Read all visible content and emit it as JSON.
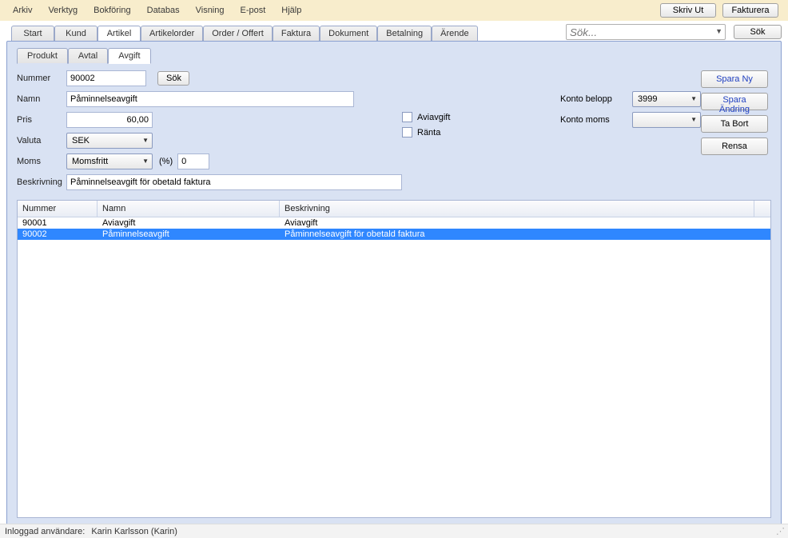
{
  "menu": [
    "Arkiv",
    "Verktyg",
    "Bokföring",
    "Databas",
    "Visning",
    "E-post",
    "Hjälp"
  ],
  "topButtons": {
    "print": "Skriv Ut",
    "invoice": "Fakturera"
  },
  "search": {
    "placeholder": "Sök...",
    "button": "Sök"
  },
  "mainTabs": [
    "Start",
    "Kund",
    "Artikel",
    "Artikelorder",
    "Order / Offert",
    "Faktura",
    "Dokument",
    "Betalning",
    "Ärende"
  ],
  "mainActive": 2,
  "subTabs": [
    "Produkt",
    "Avtal",
    "Avgift"
  ],
  "subActive": 2,
  "labels": {
    "nummer": "Nummer",
    "namn": "Namn",
    "pris": "Pris",
    "valuta": "Valuta",
    "moms": "Moms",
    "beskrivning": "Beskrivning",
    "kontoBelopp": "Konto belopp",
    "kontoMoms": "Konto moms",
    "percent": "(%)",
    "aviavgift": "Aviavgift",
    "ranta": "Ränta",
    "sok": "Sök"
  },
  "values": {
    "nummer": "90002",
    "namn": "Påminnelseavgift",
    "pris": "60,00",
    "valuta": "SEK",
    "moms": "Momsfritt",
    "momsPct": "0",
    "beskrivning": "Påminnelseavgift för obetald faktura",
    "kontoBelopp": "3999",
    "kontoMoms": ""
  },
  "actions": {
    "sparaNy": "Spara Ny",
    "sparaAndring": "Spara Ändring",
    "taBort": "Ta Bort",
    "rensa": "Rensa"
  },
  "grid": {
    "headers": {
      "nummer": "Nummer",
      "namn": "Namn",
      "beskrivning": "Beskrivning"
    },
    "rows": [
      {
        "nummer": "90001",
        "namn": "Aviavgift",
        "beskrivning": "Aviavgift",
        "selected": false
      },
      {
        "nummer": "90002",
        "namn": "Påminnelseavgift",
        "beskrivning": "Påminnelseavgift för obetald faktura",
        "selected": true
      }
    ]
  },
  "status": {
    "prefix": "Inloggad användare:",
    "user": "Karin Karlsson (Karin)"
  }
}
